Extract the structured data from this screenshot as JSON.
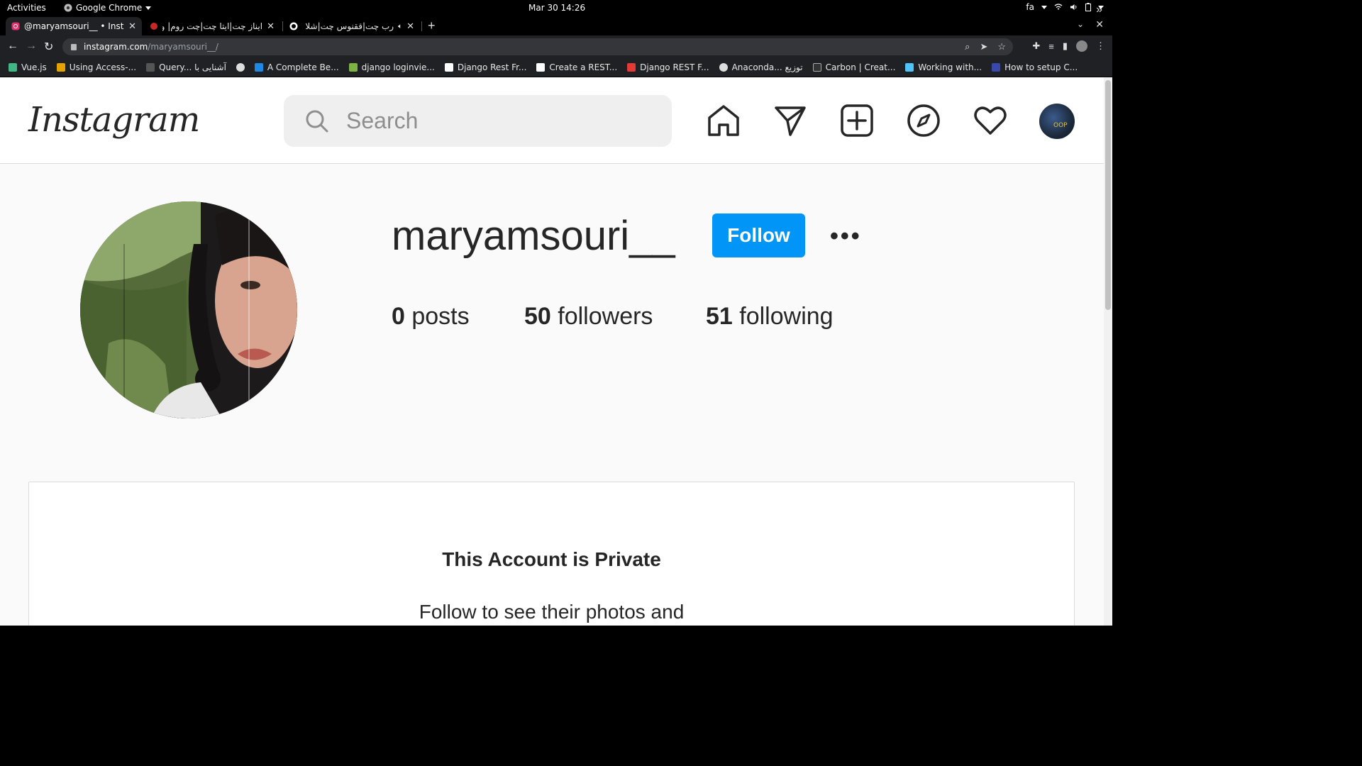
{
  "system_bar": {
    "activities": "Activities",
    "app_name": "Google Chrome",
    "clock": "Mar 30  14:26",
    "lang": "fa"
  },
  "tabs": [
    {
      "title": "@maryamsouri__ • Instag",
      "active": true
    },
    {
      "title": "ایناز چت|ایتا چت|چت روم| و",
      "active": false
    },
    {
      "title": "رب چت|ققنوس چت|شلا",
      "active": false
    }
  ],
  "omnibox": {
    "domain": "instagram.com",
    "path": "/maryamsouri__/"
  },
  "bookmarks": [
    {
      "label": "Vue.js",
      "color": "#41b883"
    },
    {
      "label": "Using Access-...",
      "color": "#e5a100"
    },
    {
      "label": "Query... آشنایی با",
      "color": "#555555"
    },
    {
      "label": "",
      "color": "#dddddd"
    },
    {
      "label": "A Complete Be...",
      "color": "#1e88e5"
    },
    {
      "label": "django loginvie...",
      "color": "#7cb342"
    },
    {
      "label": "Django Rest Fr...",
      "color": "#ffffff"
    },
    {
      "label": "Create a REST...",
      "color": "#ffffff"
    },
    {
      "label": "Django REST F...",
      "color": "#e53935"
    },
    {
      "label": "Anaconda... توزیع",
      "color": "#dddddd"
    },
    {
      "label": "Carbon | Creat...",
      "color": "#333333"
    },
    {
      "label": "Working with...",
      "color": "#4fc3f7"
    },
    {
      "label": "How to setup C...",
      "color": "#3949ab"
    }
  ],
  "instagram": {
    "logo": "Instagram",
    "search_placeholder": "Search",
    "profile": {
      "username": "maryamsouri__",
      "follow_label": "Follow",
      "more_label": "•••",
      "posts_count": "0",
      "posts_label": " posts",
      "followers_count": "50",
      "followers_label": " followers",
      "following_count": "51",
      "following_label": " following"
    },
    "private": {
      "title": "This Account is Private",
      "subtitle": "Follow to see their photos and"
    },
    "avatar_small_label": "OOP",
    "accent_color": "#0095f6"
  }
}
